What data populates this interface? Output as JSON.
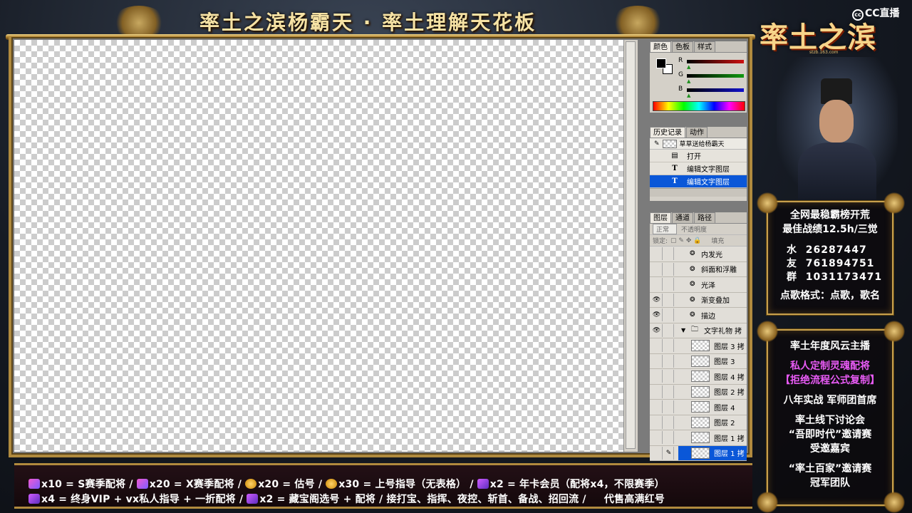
{
  "stream": {
    "title": "率土之滨杨霸天 · 率土理解天花板",
    "platform_logo": "CC直播",
    "brand": "率土之滨",
    "brand_url": "stzb.163.com"
  },
  "photoshop": {
    "color_panel": {
      "tabs": [
        "颜色",
        "色板",
        "样式"
      ],
      "channels": [
        {
          "label": "R",
          "color": "#cc1111"
        },
        {
          "label": "G",
          "color": "#119911"
        },
        {
          "label": "B",
          "color": "#1111cc"
        }
      ]
    },
    "history_panel": {
      "tabs": [
        "历史记录",
        "动作"
      ],
      "snapshot": "草草送给杨霸天",
      "items": [
        {
          "icon": "open-doc-icon",
          "glyph": "▤",
          "label": "打开"
        },
        {
          "icon": "text-tool-icon",
          "glyph": "T",
          "label": "编辑文字图层"
        },
        {
          "icon": "text-tool-icon",
          "glyph": "T",
          "label": "编辑文字图层"
        }
      ]
    },
    "layers_panel": {
      "tabs": [
        "图层",
        "通道",
        "路径"
      ],
      "blend_mode": "正常",
      "opacity_label": "不透明度",
      "lock_label": "锁定:",
      "fill_label": "填充",
      "effects": [
        "内发光",
        "斜面和浮雕",
        "光泽",
        "渐变叠加",
        "描边"
      ],
      "group_name": "文字礼物 拷",
      "layers": [
        "图层 3 拷",
        "图层 3",
        "图层 4 拷",
        "图层 2 拷",
        "图层 4",
        "图层 2",
        "图层 1 拷",
        "图层 1 拷"
      ]
    }
  },
  "sidebar": {
    "box1": {
      "line1": "全网最稳霸榜开荒",
      "line2": "最佳战绩12.5h/三觉",
      "contacts": [
        {
          "label": "水",
          "value": "26287447"
        },
        {
          "label": "友",
          "value": "761894751"
        },
        {
          "label": "群",
          "value": "1031173471"
        }
      ],
      "request_format": "点歌格式：点歌，歌名"
    },
    "box2": {
      "l1": "率土年度风云主播",
      "l2": "私人定制灵魂配将",
      "l3": "【拒绝流程公式复制】",
      "l4": "八年实战 军师团首席",
      "l5": "率土线下讨论会",
      "l6": "“吾即时代”邀请赛",
      "l7": "受邀嘉宾",
      "l8": "“率土百家”邀请赛",
      "l9": "冠军团队"
    }
  },
  "gift_bar": {
    "row1": [
      {
        "icon": "horn-gift-icon",
        "text": "x10 = S赛季配将 /"
      },
      {
        "icon": "horn-gift-icon",
        "text": "x20 = X赛季配将 /"
      },
      {
        "icon": "hand-gift-icon",
        "text": "x20 = 估号 /"
      },
      {
        "icon": "hand-gift-icon",
        "text": "x30 = 上号指导（无表格） /"
      },
      {
        "icon": "pen-gift-icon",
        "text": "x2 = 年卡会员（配将x4，不限赛季）"
      }
    ],
    "row2": [
      {
        "icon": "pen-gift-icon",
        "text": "x4 = 终身VIP + vx私人指导 + 一折配将 /"
      },
      {
        "icon": "pen-gift-icon",
        "text": "x2 = 藏宝阁选号 + 配将 / 接打宝、指挥、夜控、斩首、备战、招回流 /"
      },
      {
        "icon": "",
        "text": "代售高满红号"
      }
    ]
  }
}
